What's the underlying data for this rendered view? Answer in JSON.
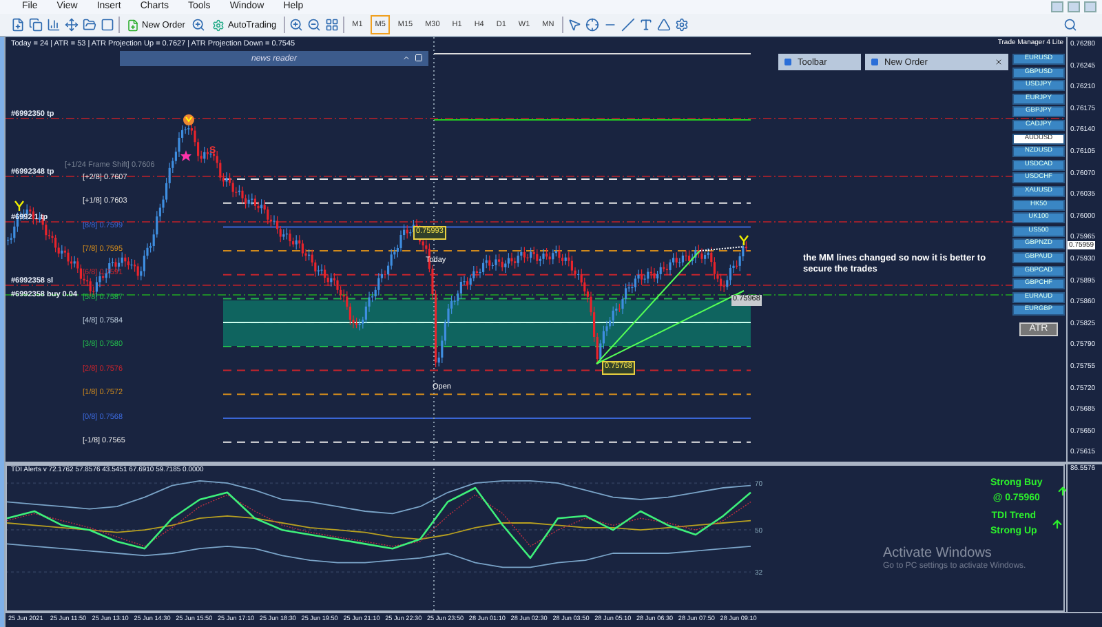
{
  "menu": [
    "File",
    "View",
    "Insert",
    "Charts",
    "Tools",
    "Window",
    "Help"
  ],
  "toolbar": {
    "buttons": [
      {
        "label": "New Order"
      },
      {
        "label": "AutoTrading"
      }
    ],
    "timeframes": [
      {
        "label": "M1",
        "selected": false
      },
      {
        "label": "M5",
        "selected": true
      },
      {
        "label": "M15",
        "selected": false
      },
      {
        "label": "M30",
        "selected": false
      },
      {
        "label": "H1",
        "selected": false
      },
      {
        "label": "H4",
        "selected": false
      },
      {
        "label": "D1",
        "selected": false
      },
      {
        "label": "W1",
        "selected": false
      },
      {
        "label": "MN",
        "selected": false
      }
    ]
  },
  "chart": {
    "info": "Today = 24  |  ATR = 53  |  ATR Projection Up = 0.7627  |  ATR Projection Down = 0.7545",
    "news_reader": {
      "title": "news reader"
    },
    "trade_labels": [
      "#6992350 tp",
      "#6992348 tp",
      "#6992 1 tp",
      "#6992358 sl",
      "#6992358 buy 0.04"
    ],
    "frame_shift": "[+1/24 Frame Shift]  0.7606",
    "mm_levels": [
      {
        "label": "[+2/8]",
        "value": "0.7607",
        "color": "#e8e8e8"
      },
      {
        "label": "[+1/8]",
        "value": "0.7603",
        "color": "#e8e8e8"
      },
      {
        "label": "[8/8]",
        "value": "0.7599",
        "color": "#3a66d6"
      },
      {
        "label": "[7/8]",
        "value": "0.7595",
        "color": "#d08a1c"
      },
      {
        "label": "[6/8]",
        "value": "0.7591",
        "color": "#c8242c"
      },
      {
        "label": "[5/8]",
        "value": "0.7587",
        "color": "#22b84c"
      },
      {
        "label": "[4/8]",
        "value": "0.7584",
        "color": "#b8c8d8"
      },
      {
        "label": "[3/8]",
        "value": "0.7580",
        "color": "#22b84c"
      },
      {
        "label": "[2/8]",
        "value": "0.7576",
        "color": "#c8242c"
      },
      {
        "label": "[1/8]",
        "value": "0.7572",
        "color": "#d08a1c"
      },
      {
        "label": "[0/8]",
        "value": "0.7568",
        "color": "#3a66d6"
      },
      {
        "label": "[-1/8]",
        "value": "0.7565",
        "color": "#e8e8e8"
      }
    ],
    "tags": [
      {
        "kind": "highlight",
        "text": "0.75993"
      },
      {
        "kind": "plain",
        "text": "Today"
      },
      {
        "kind": "plain",
        "text": "Open"
      },
      {
        "kind": "highlight",
        "text": "0.75768"
      },
      {
        "kind": "box",
        "text": "0.75968"
      }
    ],
    "sell_mark": "S",
    "comment": "the MM lines changed so now it is better to secure the trades",
    "panels": [
      {
        "title": "Toolbar"
      },
      {
        "title": "New Order"
      }
    ],
    "trade_manager": "Trade Manager 4 Lite",
    "symbols": [
      {
        "label": "EURUSD",
        "selected": false
      },
      {
        "label": "GBPUSD",
        "selected": false
      },
      {
        "label": "USDJPY",
        "selected": false
      },
      {
        "label": "EURJPY",
        "selected": false
      },
      {
        "label": "GBPJPY",
        "selected": false
      },
      {
        "label": "CADJPY",
        "selected": false
      },
      {
        "label": "AUDUSD",
        "selected": true
      },
      {
        "label": "NZDUSD",
        "selected": false
      },
      {
        "label": "USDCAD",
        "selected": false
      },
      {
        "label": "USDCHF",
        "selected": false
      },
      {
        "label": "XAUUSD",
        "selected": false
      },
      {
        "label": "HK50",
        "selected": false
      },
      {
        "label": "UK100",
        "selected": false
      },
      {
        "label": "US500",
        "selected": false
      },
      {
        "label": "GBPNZD",
        "selected": false
      },
      {
        "label": "GBPAUD",
        "selected": false
      },
      {
        "label": "GBPCAD",
        "selected": false
      },
      {
        "label": "GBPCHF",
        "selected": false
      },
      {
        "label": "EURAUD",
        "selected": false
      },
      {
        "label": "EURGBP",
        "selected": false
      }
    ],
    "atr_button": "ATR",
    "price_axis": [
      "0.76280",
      "0.76245",
      "0.76210",
      "0.76175",
      "0.76140",
      "0.76105",
      "0.76070",
      "0.76035",
      "0.76000",
      "0.75965",
      "0.75930",
      "0.75895",
      "0.75860",
      "0.75825",
      "0.75790",
      "0.75755",
      "0.75720",
      "0.75685",
      "0.75650",
      "0.75615"
    ],
    "current_price": "0.75959"
  },
  "indicator": {
    "title": "TDI Alerts v 72.1762 57.8576 43.5451 67.6910 59.7185 0.0000",
    "axis_label": "86.5576",
    "chart_data": {
      "type": "line",
      "ylim": [
        15,
        78
      ],
      "yticks": [
        {
          "value": 32,
          "label": "32"
        },
        {
          "value": 50,
          "label": "50"
        },
        {
          "value": 70,
          "label": "70"
        }
      ],
      "series": [
        {
          "color": "#7aa4c8",
          "values": [
            62,
            61,
            60,
            59,
            60,
            64,
            69,
            71,
            70,
            67,
            63,
            62,
            60,
            58,
            57,
            60,
            66,
            70,
            71,
            71,
            70,
            67,
            64,
            63,
            64,
            66,
            68,
            69
          ]
        },
        {
          "color": "#7aa4c8",
          "values": [
            44,
            43,
            42,
            41,
            40,
            39,
            40,
            42,
            43,
            42,
            39,
            37,
            36,
            36,
            37,
            38,
            40,
            36,
            34,
            34,
            36,
            37,
            40,
            40,
            40,
            41,
            42,
            43
          ]
        },
        {
          "color": "#b8a020",
          "values": [
            53,
            52,
            51,
            50,
            49,
            50,
            52,
            55,
            56,
            55,
            53,
            51,
            50,
            49,
            47,
            46,
            48,
            51,
            53,
            53,
            52,
            51,
            51,
            50,
            51,
            52,
            53,
            54
          ]
        },
        {
          "color": "#c03040",
          "line_style": "dashed",
          "values": [
            54,
            57,
            54,
            51,
            47,
            43,
            51,
            60,
            65,
            58,
            52,
            49,
            47,
            45,
            43,
            45,
            56,
            65,
            57,
            43,
            50,
            55,
            52,
            55,
            53,
            50,
            54,
            62
          ]
        },
        {
          "color": "#3ef07a",
          "values": [
            55,
            58,
            52,
            50,
            45,
            42,
            55,
            63,
            66,
            55,
            50,
            48,
            46,
            44,
            42,
            46,
            62,
            68,
            52,
            38,
            55,
            56,
            50,
            58,
            52,
            48,
            56,
            66
          ]
        }
      ]
    },
    "signals": [
      {
        "lines": [
          "Strong Buy",
          "@ 0.75960"
        ]
      },
      {
        "lines": [
          "TDI Trend",
          "Strong Up"
        ]
      }
    ]
  },
  "time_axis": [
    "25 Jun 2021",
    "25 Jun 11:50",
    "25 Jun 13:10",
    "25 Jun 14:30",
    "25 Jun 15:50",
    "25 Jun 17:10",
    "25 Jun 18:30",
    "25 Jun 19:50",
    "25 Jun 21:10",
    "25 Jun 22:30",
    "25 Jun 23:50",
    "28 Jun 01:10",
    "28 Jun 02:30",
    "28 Jun 03:50",
    "28 Jun 05:10",
    "28 Jun 06:30",
    "28 Jun 07:50",
    "28 Jun 09:10"
  ],
  "os_notice": {
    "title": "Activate Windows",
    "text": "Go to PC settings to activate Windows."
  }
}
